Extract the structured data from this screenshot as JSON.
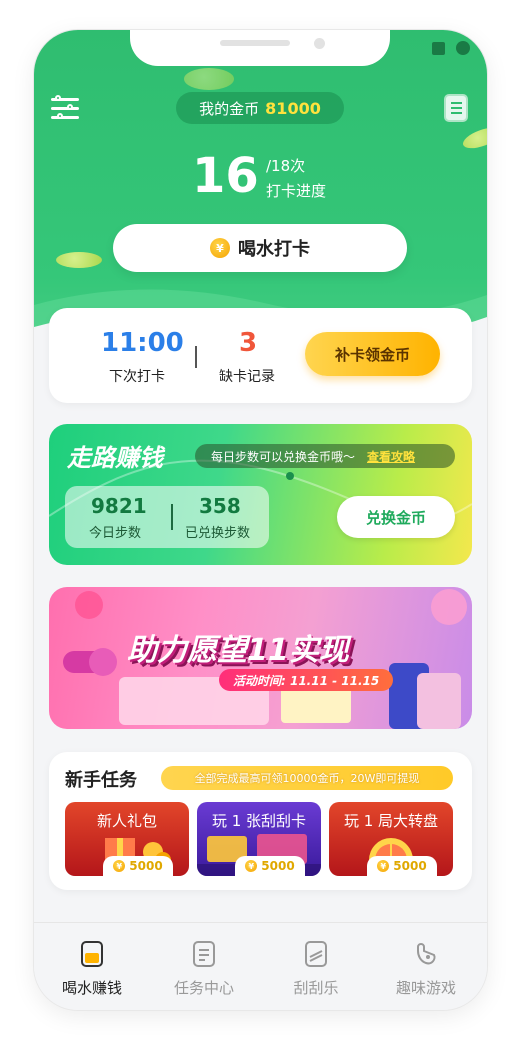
{
  "header": {
    "coin_label": "我的金币",
    "coin_amount": "81000",
    "progress_current": "16",
    "progress_total": "/18次",
    "progress_label": "打卡进度",
    "checkin_button": "喝水打卡",
    "coin_symbol": "¥"
  },
  "checkin_card": {
    "next_time": "11:00",
    "next_label": "下次打卡",
    "missed_count": "3",
    "missed_label": "缺卡记录",
    "makeup_button": "补卡领金币"
  },
  "walk_card": {
    "title": "走路赚钱",
    "tip": "每日步数可以兑换金币哦～",
    "tip_link": "查看攻略",
    "today_steps": "9821",
    "today_label": "今日步数",
    "exchanged_steps": "358",
    "exchanged_label": "已兑换步数",
    "exchange_button": "兑换金币"
  },
  "banner": {
    "title": "助力愿望11实现",
    "date": "活动时间: 11.11 - 11.15"
  },
  "tasks": {
    "title": "新手任务",
    "tip": "全部完成最高可领10000金币，20W即可提现",
    "items": [
      {
        "label": "新人礼包",
        "reward": "5000"
      },
      {
        "label": "玩 1 张刮刮卡",
        "reward": "5000"
      },
      {
        "label": "玩 1 局大转盘",
        "reward": "5000"
      }
    ]
  },
  "tabbar": {
    "items": [
      {
        "label": "喝水赚钱",
        "icon": "cup-icon",
        "active": true
      },
      {
        "label": "任务中心",
        "icon": "task-list-icon",
        "active": false
      },
      {
        "label": "刮刮乐",
        "icon": "scratch-card-icon",
        "active": false
      },
      {
        "label": "趣味游戏",
        "icon": "game-icon",
        "active": false
      }
    ]
  },
  "colors": {
    "brand_green": "#2fbd70",
    "accent_yellow": "#ffd54f",
    "time_blue": "#2b7fe8",
    "missed_red": "#f0563a"
  }
}
